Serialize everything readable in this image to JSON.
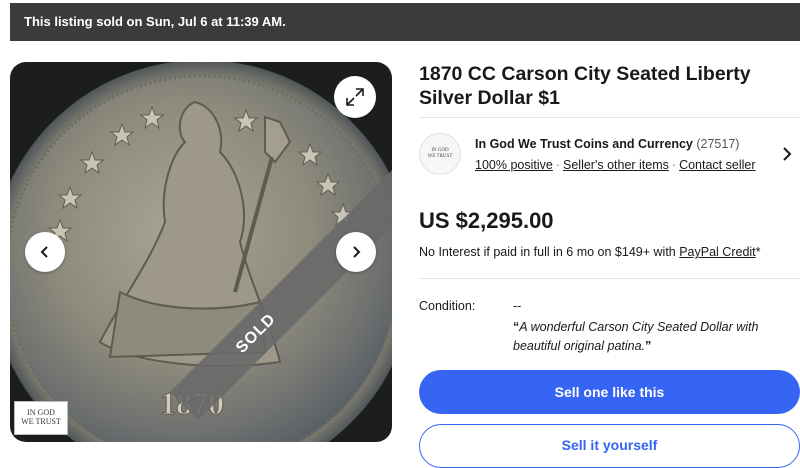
{
  "banner": {
    "text": "This listing sold on Sun, Jul 6 at 11:39 AM."
  },
  "gallery": {
    "sold_label": "SOLD",
    "logo_line1": "IN GOD",
    "logo_line2": "WE TRUST",
    "coin_year": "1870",
    "icons": {
      "expand": "expand-icon",
      "prev": "chevron-left-icon",
      "next": "chevron-right-icon"
    }
  },
  "item": {
    "title": "1870 CC Carson City Seated Liberty Silver Dollar $1",
    "price": "US $2,295.00",
    "credit_prefix": "No Interest if paid in full in 6 mo on $149+ with ",
    "credit_link": "PayPal Credit",
    "credit_suffix": "*"
  },
  "seller": {
    "logo_line1": "IN GOD",
    "logo_line2": "WE TRUST",
    "name": "In God We Trust Coins and Currency",
    "feedback_count": "(27517)",
    "positive": "100% positive",
    "other_items": "Seller's other items",
    "contact": "Contact seller"
  },
  "condition": {
    "label": "Condition:",
    "value": "--",
    "quote_open": "“",
    "quote": "A wonderful Carson City Seated Dollar with beautiful original patina.",
    "quote_close": "”"
  },
  "actions": {
    "sell_one": "Sell one like this",
    "sell_it": "Sell it yourself"
  },
  "colors": {
    "accent": "#3665f3",
    "banner": "#3b3b3b"
  }
}
